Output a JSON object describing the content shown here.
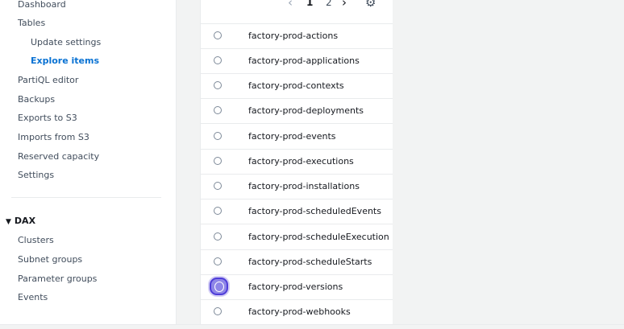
{
  "sidebar": {
    "items": [
      {
        "label": "Dashboard"
      },
      {
        "label": "Tables"
      },
      {
        "label": "Update settings"
      },
      {
        "label": "Explore items"
      },
      {
        "label": "PartiQL editor"
      },
      {
        "label": "Backups"
      },
      {
        "label": "Exports to S3"
      },
      {
        "label": "Imports from S3"
      },
      {
        "label": "Reserved capacity"
      },
      {
        "label": "Settings"
      }
    ],
    "dax": {
      "caret": "▼",
      "header": "DAX",
      "items": [
        {
          "label": "Clusters"
        },
        {
          "label": "Subnet groups"
        },
        {
          "label": "Parameter groups"
        },
        {
          "label": "Events"
        }
      ]
    }
  },
  "pagination": {
    "prev_icon": "‹",
    "pages": [
      "1",
      "2"
    ],
    "next_icon": "›",
    "settings_icon": "⚙"
  },
  "tables": [
    {
      "name": "factory-prod-actions"
    },
    {
      "name": "factory-prod-applications"
    },
    {
      "name": "factory-prod-contexts"
    },
    {
      "name": "factory-prod-deployments"
    },
    {
      "name": "factory-prod-events"
    },
    {
      "name": "factory-prod-executions"
    },
    {
      "name": "factory-prod-installations"
    },
    {
      "name": "factory-prod-scheduledEvents"
    },
    {
      "name": "factory-prod-scheduleExecution"
    },
    {
      "name": "factory-prod-scheduleStarts"
    },
    {
      "name": "factory-prod-versions"
    },
    {
      "name": "factory-prod-webhooks"
    }
  ],
  "colors": {
    "active_link": "#0972d3",
    "focus_ring": "#4f3dd8"
  }
}
